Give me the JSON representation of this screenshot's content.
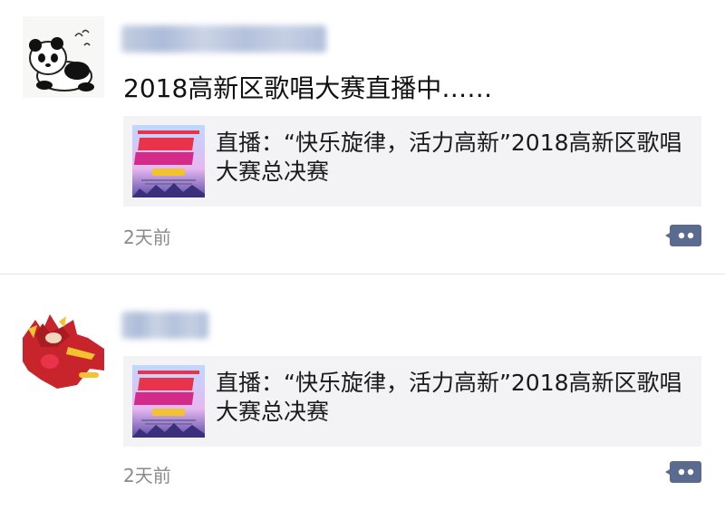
{
  "moments": [
    {
      "user_name": "",
      "text": "2018高新区歌唱大赛直播中……",
      "link_title": "直播：“快乐旋律，活力高新”2018高新区歌唱大赛总决赛",
      "time": "2天前",
      "avatar_icon": "panda-avatar-icon",
      "thumbnail_icon": "concert-poster-thumbnail"
    },
    {
      "user_name": "",
      "link_title": "直播：“快乐旋律，活力高新”2018高新区歌唱大赛总决赛",
      "time": "2天前",
      "avatar_icon": "red-hero-avatar-icon",
      "thumbnail_icon": "concert-poster-thumbnail"
    }
  ],
  "colors": {
    "card_background": "#f3f3f5",
    "timestamp": "#8a8a8a",
    "comment_button": "#5b6b8f"
  }
}
